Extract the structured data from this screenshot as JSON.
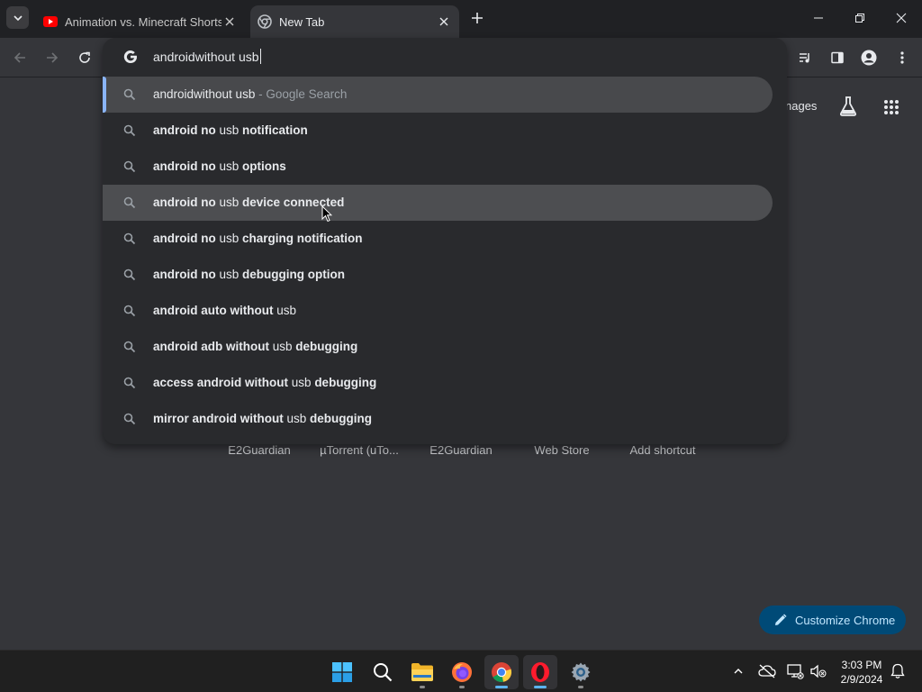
{
  "browser": {
    "tabs": [
      {
        "title": "Animation vs. Minecraft Shorts",
        "active": false,
        "favicon": "youtube-icon"
      },
      {
        "title": "New Tab",
        "active": true,
        "favicon": "chrome-icon"
      }
    ]
  },
  "omnibox": {
    "typed": "androidwithout usb",
    "suggestions": [
      {
        "parts": [
          {
            "t": "androidwithout usb",
            "s": "n"
          },
          {
            "t": " - Google Search",
            "s": "h"
          }
        ]
      },
      {
        "parts": [
          {
            "t": "android no ",
            "s": "b"
          },
          {
            "t": "usb",
            "s": "n"
          },
          {
            "t": " notification",
            "s": "b"
          }
        ]
      },
      {
        "parts": [
          {
            "t": "android no ",
            "s": "b"
          },
          {
            "t": "usb",
            "s": "n"
          },
          {
            "t": " options",
            "s": "b"
          }
        ]
      },
      {
        "parts": [
          {
            "t": "android no ",
            "s": "b"
          },
          {
            "t": "usb",
            "s": "n"
          },
          {
            "t": " device connected",
            "s": "b"
          }
        ]
      },
      {
        "parts": [
          {
            "t": "android no ",
            "s": "b"
          },
          {
            "t": "usb",
            "s": "n"
          },
          {
            "t": " charging notification",
            "s": "b"
          }
        ]
      },
      {
        "parts": [
          {
            "t": "android no ",
            "s": "b"
          },
          {
            "t": "usb",
            "s": "n"
          },
          {
            "t": " debugging option",
            "s": "b"
          }
        ]
      },
      {
        "parts": [
          {
            "t": "android auto without ",
            "s": "b"
          },
          {
            "t": "usb",
            "s": "n"
          }
        ]
      },
      {
        "parts": [
          {
            "t": "android adb without ",
            "s": "b"
          },
          {
            "t": "usb",
            "s": "n"
          },
          {
            "t": " debugging",
            "s": "b"
          }
        ]
      },
      {
        "parts": [
          {
            "t": "access android without ",
            "s": "b"
          },
          {
            "t": "usb",
            "s": "n"
          },
          {
            "t": " debugging",
            "s": "b"
          }
        ]
      },
      {
        "parts": [
          {
            "t": "mirror android without ",
            "s": "b"
          },
          {
            "t": "usb",
            "s": "n"
          },
          {
            "t": " debugging",
            "s": "b"
          }
        ]
      }
    ]
  },
  "ntp": {
    "images_label": "nages",
    "shortcuts": [
      "E2Guardian",
      "µTorrent (uTo...",
      "E2Guardian",
      "Web Store",
      "Add shortcut"
    ],
    "customize_label": "Customize Chrome"
  },
  "taskbar": {
    "time": "3:03 PM",
    "date": "2/9/2024"
  },
  "colors": {
    "accent": "#8ab4f8",
    "customize_bg": "#004a77",
    "youtube_red": "#ff0000"
  }
}
